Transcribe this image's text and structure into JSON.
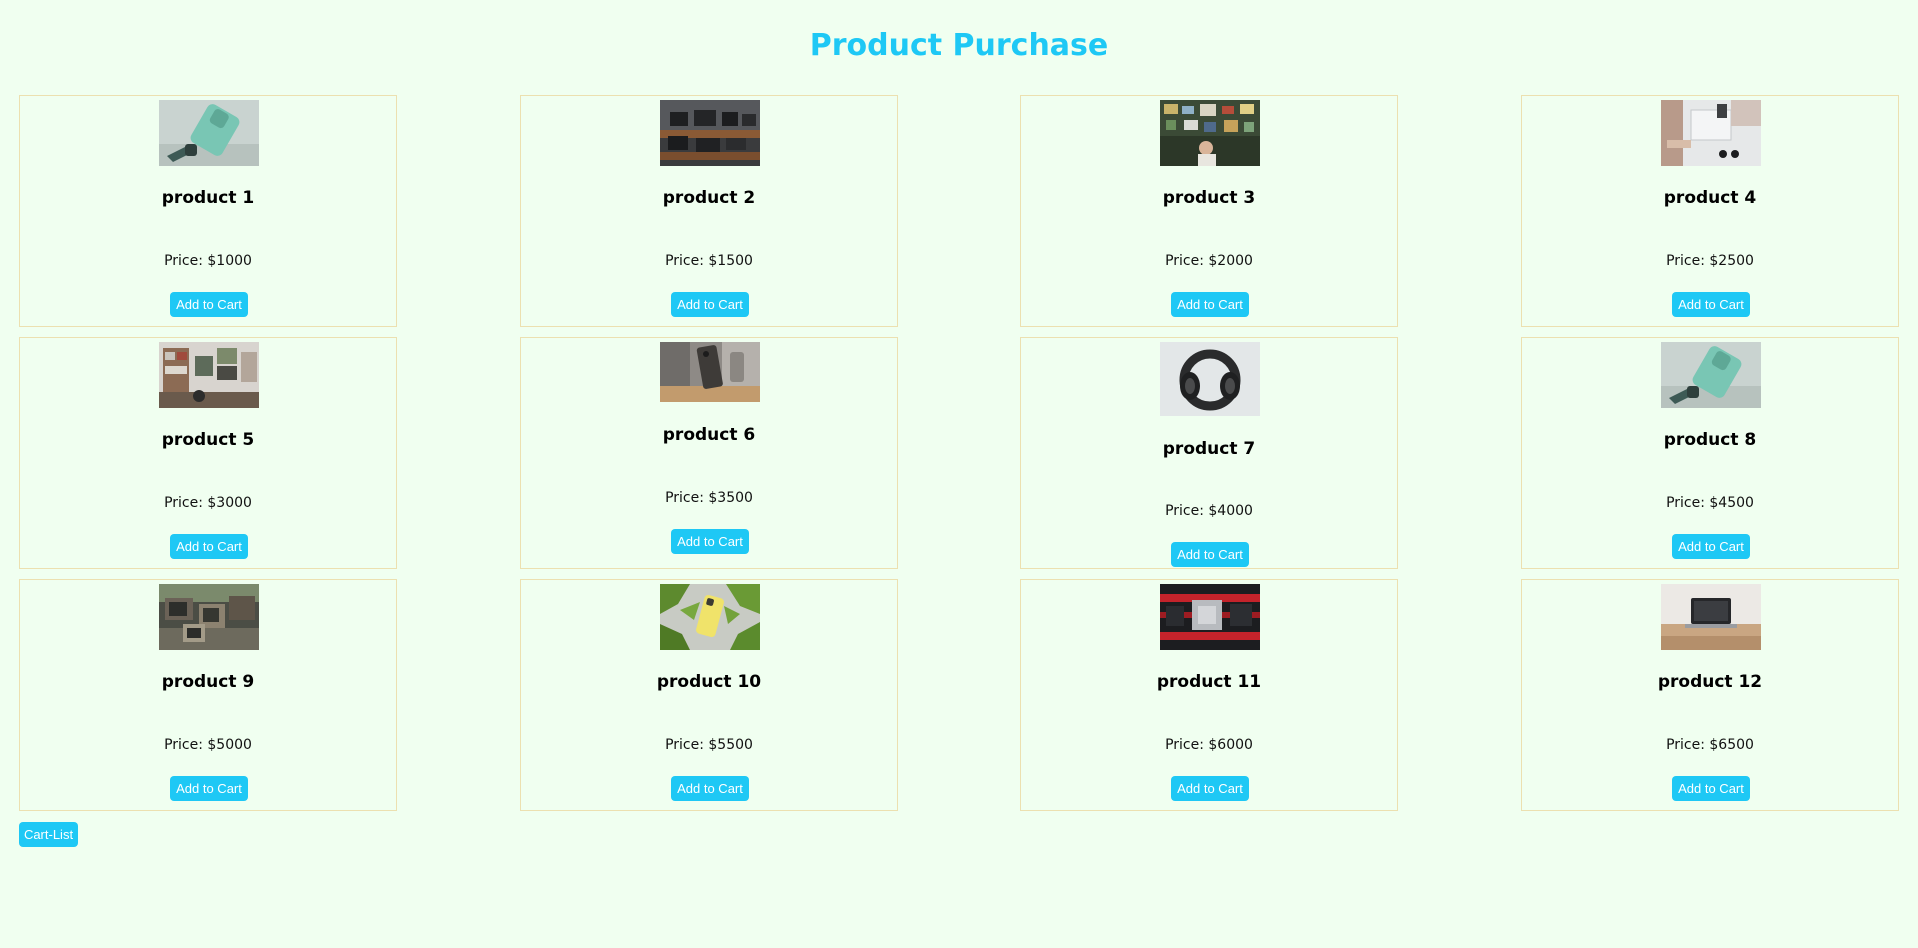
{
  "page": {
    "title": "Product Purchase",
    "cart_list_label": "Cart-List"
  },
  "colors": {
    "background": "#f0fff0",
    "accent": "#1ec8f5",
    "card_border": "#ece0b0"
  },
  "products": [
    {
      "name": "product 1",
      "price": "Price: $1000",
      "button": "Add to Cart",
      "image": "green-phone-with-watch"
    },
    {
      "name": "product 2",
      "price": "Price: $1500",
      "button": "Add to Cart",
      "image": "camera-shelf"
    },
    {
      "name": "product 3",
      "price": "Price: $2000",
      "button": "Add to Cart",
      "image": "electronics-store-shelves"
    },
    {
      "name": "product 4",
      "price": "Price: $2500",
      "button": "Add to Cart",
      "image": "white-desk-with-gadgets"
    },
    {
      "name": "product 5",
      "price": "Price: $3000",
      "button": "Add to Cart",
      "image": "retro-electronics-shop"
    },
    {
      "name": "product 6",
      "price": "Price: $3500",
      "button": "Add to Cart",
      "image": "phone-on-stand"
    },
    {
      "name": "product 7",
      "price": "Price: $4000",
      "button": "Add to Cart",
      "image": "headphones"
    },
    {
      "name": "product 8",
      "price": "Price: $4500",
      "button": "Add to Cart",
      "image": "green-phone-with-watch"
    },
    {
      "name": "product 9",
      "price": "Price: $5000",
      "button": "Add to Cart",
      "image": "vintage-tv-pile"
    },
    {
      "name": "product 10",
      "price": "Price: $5500",
      "button": "Add to Cart",
      "image": "yellow-phone-on-leaves"
    },
    {
      "name": "product 11",
      "price": "Price: $6000",
      "button": "Add to Cart",
      "image": "computer-motherboard"
    },
    {
      "name": "product 12",
      "price": "Price: $6500",
      "button": "Add to Cart",
      "image": "laptop-on-desk"
    }
  ]
}
